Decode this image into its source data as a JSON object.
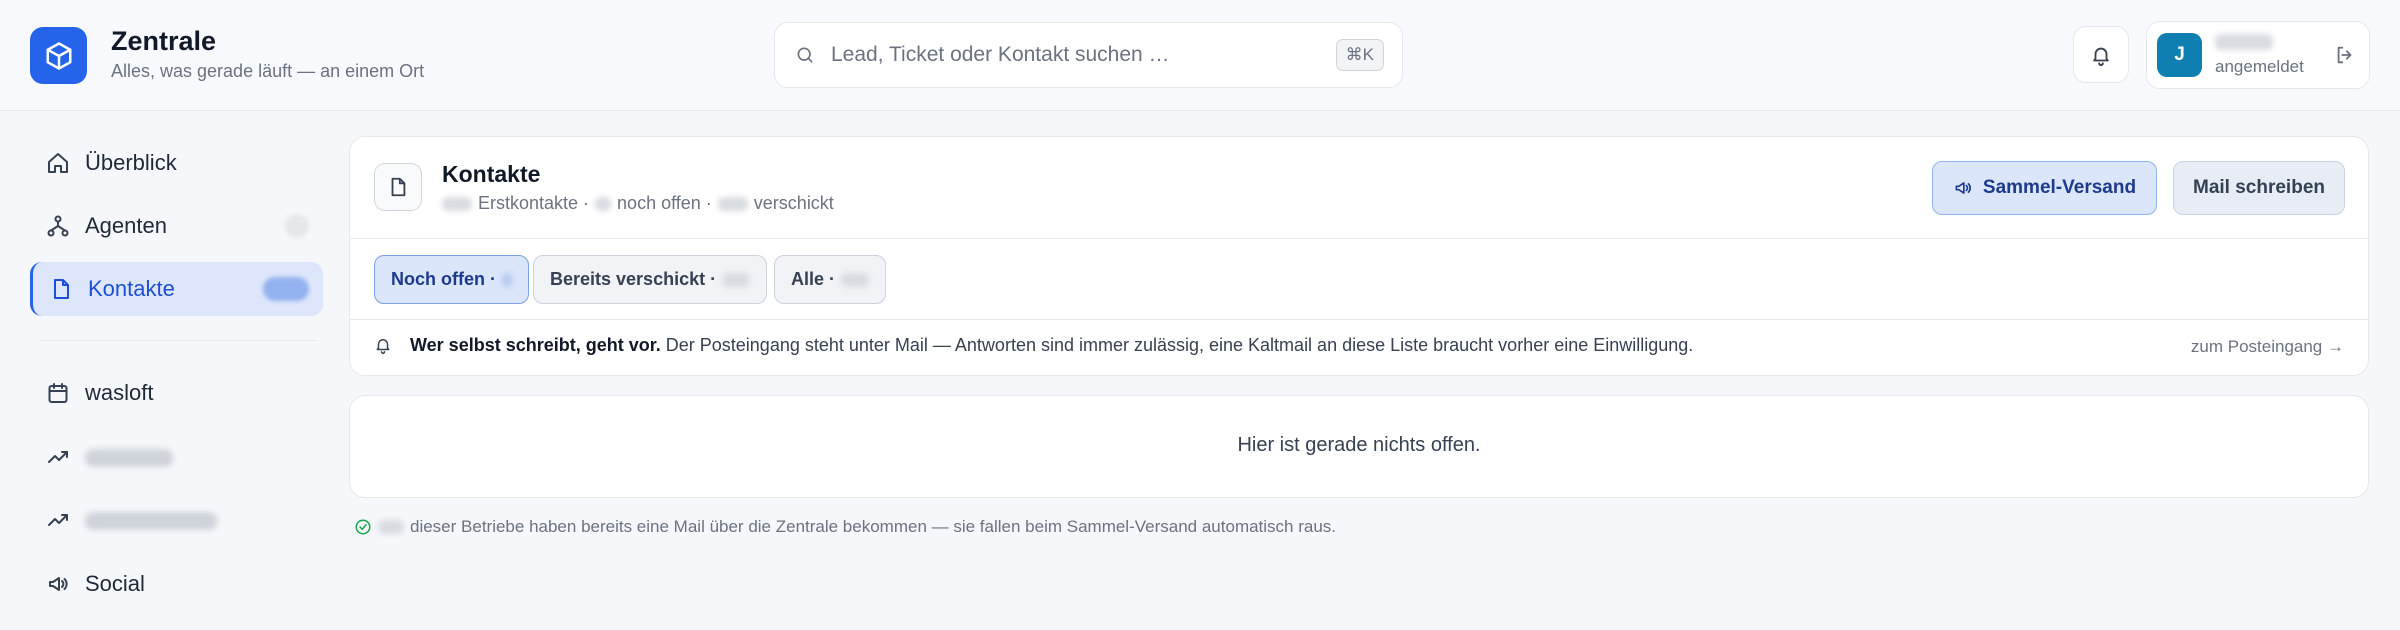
{
  "app": {
    "title": "Zentrale",
    "subtitle": "Alles, was gerade läuft — an einem Ort",
    "brand_color": "#2563eb"
  },
  "search": {
    "placeholder": "Lead, Ticket oder Kontakt suchen …",
    "shortcut": "⌘K",
    "icon": "search-icon"
  },
  "user": {
    "initial": "J",
    "status": "angemeldet",
    "avatar_color": "#0e7fb0"
  },
  "sidebar": {
    "items": [
      {
        "label": "Überblick",
        "icon": "home-icon"
      },
      {
        "label": "Agenten",
        "icon": "agents-icon"
      },
      {
        "label": "Kontakte",
        "icon": "document-icon",
        "active": true
      },
      {
        "label": "wasloft",
        "icon": "calendar-icon"
      },
      {
        "label": "",
        "icon": "trending-icon"
      },
      {
        "label": "",
        "icon": "trending-icon"
      },
      {
        "label": "Social",
        "icon": "megaphone-icon"
      }
    ]
  },
  "contacts": {
    "title": "Kontakte",
    "sub_first": "Erstkontakte ·",
    "sub_open": "noch offen ·",
    "sub_sent": "verschickt",
    "bulk_send_label": "Sammel-Versand",
    "write_mail_label": "Mail schreiben",
    "tabs": [
      {
        "label": "Noch offen ·",
        "active": true
      },
      {
        "label": "Bereits verschickt ·",
        "active": false
      },
      {
        "label": "Alle ·",
        "active": false
      }
    ],
    "notice_bold": "Wer selbst schreibt, geht vor.",
    "notice_text": "Der Posteingang steht unter Mail — Antworten sind immer zulässig, eine Kaltmail an diese Liste braucht vorher eine Einwilligung.",
    "notice_link": "zum Posteingang →",
    "empty_text": "Hier ist gerade nichts offen.",
    "footer_text": "dieser Betriebe haben bereits eine Mail über die Zentrale bekommen — sie fallen beim Sammel-Versand automatisch raus.",
    "accent_color": "#1d4ed8"
  }
}
